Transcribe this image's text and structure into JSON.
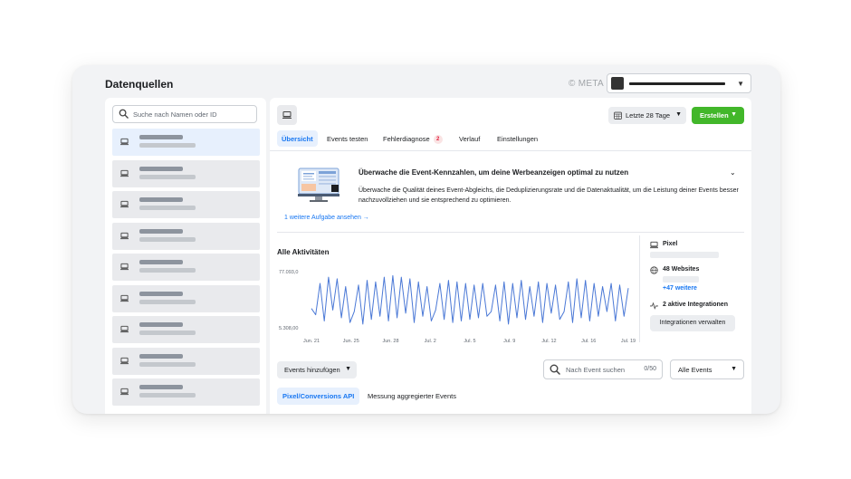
{
  "header": {
    "title": "Datenquellen",
    "meta_mark": "© META"
  },
  "sidebar": {
    "search_placeholder": "Suche nach Namen oder ID",
    "item_count": 9
  },
  "toolbar": {
    "date_range_label": "Letzte 28 Tage",
    "create_label": "Erstellen"
  },
  "tabs": [
    {
      "label": "Übersicht",
      "active": true
    },
    {
      "label": "Events testen"
    },
    {
      "label": "Fehlerdiagnose",
      "badge": "2"
    },
    {
      "label": "Verlauf"
    },
    {
      "label": "Einstellungen"
    }
  ],
  "info_card": {
    "title": "Überwache die Event-Kennzahlen, um deine Werbeanzeigen optimal zu nutzen",
    "description": "Überwache die Qualität deines Event-Abgleichs, die Deduplizierungsrate und die Datenaktualität, um die Leistung deiner Events besser nachzuvollziehen und sie entsprechend zu optimieren.",
    "link": "1 weitere Aufgabe ansehen →"
  },
  "activity": {
    "title": "Alle Aktivitäten"
  },
  "chart_data": {
    "type": "line",
    "title": "Alle Aktivitäten",
    "y_tick_labels": [
      "77.093,0",
      "5.308,00"
    ],
    "ylim": [
      5308,
      77093
    ],
    "x_tick_labels": [
      "Jun. 21",
      "Jun. 25",
      "Jun. 28",
      "Jul. 2",
      "Jul. 5",
      "Jul. 9",
      "Jul. 12",
      "Jul. 16",
      "Jul. 19"
    ],
    "grid": false,
    "series": [
      {
        "color": "#4a78d6",
        "values": [
          30000,
          22000,
          62000,
          14000,
          70000,
          28000,
          68000,
          18000,
          58000,
          12000,
          26000,
          60000,
          10000,
          66000,
          16000,
          64000,
          20000,
          70000,
          14000,
          72000,
          18000,
          70000,
          24000,
          68000,
          12000,
          64000,
          20000,
          58000,
          14000,
          28000,
          62000,
          16000,
          66000,
          12000,
          64000,
          14000,
          62000,
          16000,
          60000,
          18000,
          62000,
          20000,
          26000,
          60000,
          14000,
          64000,
          10000,
          62000,
          18000,
          66000,
          16000,
          58000,
          20000,
          64000,
          12000,
          62000,
          24000,
          60000,
          16000,
          26000,
          64000,
          12000,
          68000,
          18000,
          66000,
          14000,
          62000,
          20000,
          58000,
          26000,
          62000,
          14000,
          60000,
          20000,
          56000
        ]
      }
    ]
  },
  "pixel_panel": {
    "type_label": "Pixel",
    "websites_label": "48 Websites",
    "more_link": "+47 weitere",
    "integrations_label": "2 aktive Integrationen",
    "manage_button": "Integrationen verwalten"
  },
  "events_bar": {
    "add_label": "Events hinzufügen",
    "search_placeholder": "Nach Event suchen",
    "search_count": "0/50",
    "filter_label": "Alle Events"
  },
  "bottom_tabs": [
    {
      "label": "Pixel/Conversions API",
      "active": true
    },
    {
      "label": "Messung aggregierter Events"
    }
  ],
  "colors": {
    "accent": "#1877f2",
    "create_button": "#42b72a",
    "chart_line": "#4a78d6",
    "selected_item": "#e7f0fd"
  }
}
